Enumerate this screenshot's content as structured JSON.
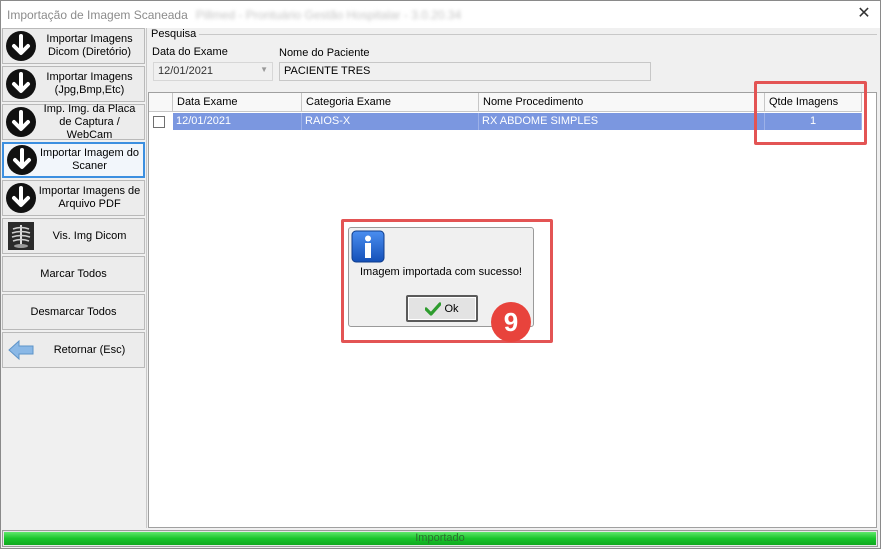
{
  "window": {
    "title": "Importação de Imagem Scaneada",
    "title_suffix": "Pillmed - Prontuário Gestão Hospitalar - 3.0.20.34",
    "close_label": "✕"
  },
  "sidebar": {
    "items": [
      {
        "label": "Importar Imagens Dicom (Diretório)",
        "icon": "arrow-down-icon"
      },
      {
        "label": "Importar Imagens (Jpg,Bmp,Etc)",
        "icon": "arrow-down-icon"
      },
      {
        "label": "Imp. Img. da Placa de Captura / WebCam",
        "icon": "arrow-down-icon"
      },
      {
        "label": "Importar Imagem do Scaner",
        "icon": "arrow-down-icon",
        "active": true
      },
      {
        "label": "Importar Imagens de Arquivo PDF",
        "icon": "arrow-down-icon"
      },
      {
        "label": "Vis. Img Dicom",
        "icon": "xray-icon"
      },
      {
        "label": "Marcar Todos"
      },
      {
        "label": "Desmarcar Todos"
      },
      {
        "label": "Retornar (Esc)",
        "icon": "back-arrow-icon"
      }
    ]
  },
  "search": {
    "group_label": "Pesquisa",
    "date_label": "Data do Exame",
    "date_value": "12/01/2021",
    "name_label": "Nome do Paciente",
    "name_value": "PACIENTE TRES"
  },
  "grid": {
    "columns": [
      "Data Exame",
      "Categoria Exame",
      "Nome Procedimento",
      "Qtde Imagens"
    ],
    "rows": [
      {
        "checked": false,
        "cells": [
          "12/01/2021",
          "RAIOS-X",
          "RX ABDOME SIMPLES",
          "1"
        ]
      }
    ]
  },
  "dialog": {
    "message": "Imagem importada com sucesso!",
    "ok_label": "Ok",
    "icon": "info-icon"
  },
  "step_badge": "9",
  "status": {
    "text": "Importado",
    "progress": 1.0
  },
  "colors": {
    "highlight": "#e35454",
    "selected_row": "#7b97e0",
    "progress": "#19c42b",
    "badge": "#e8433c"
  }
}
